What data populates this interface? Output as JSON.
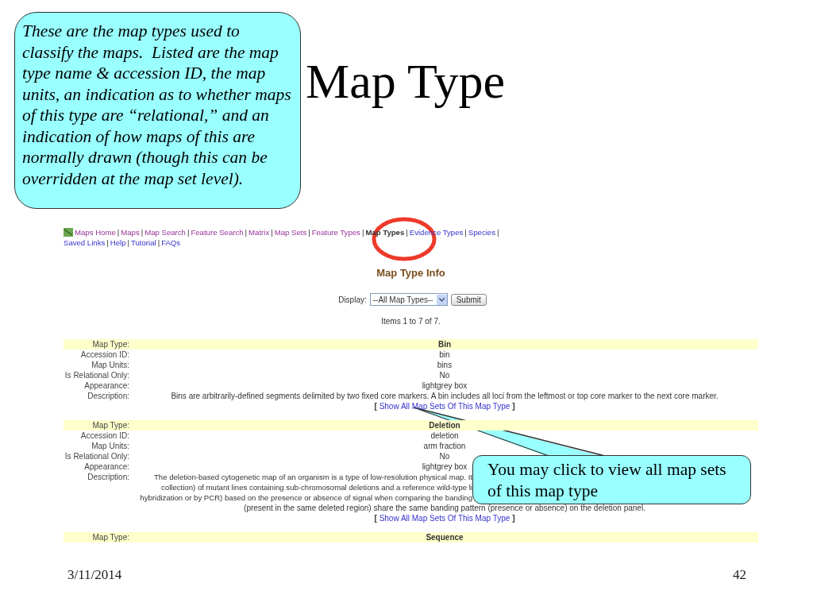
{
  "slide": {
    "title": "Map Type",
    "date": "3/11/2014",
    "page_number": "42"
  },
  "callouts": [
    {
      "kind": "note",
      "text": "These are the map types used to classify the maps.  Listed are the map type name & accession ID, the map units, an indication as to whether maps of this type are “relational,” and an indication of how maps of this are normally drawn (though this can be overridden at the map set level)."
    },
    {
      "kind": "pointer",
      "text": "You may click to view all map sets of this map type"
    }
  ],
  "screenshot": {
    "nav_separator": "|",
    "nav": [
      {
        "label": "Maps Home",
        "visited": true,
        "selected": false
      },
      {
        "label": "Maps",
        "visited": true,
        "selected": false
      },
      {
        "label": "Map Search",
        "visited": true,
        "selected": false
      },
      {
        "label": "Feature Search",
        "visited": true,
        "selected": false
      },
      {
        "label": "Matrix",
        "visited": true,
        "selected": false
      },
      {
        "label": "Map Sets",
        "visited": true,
        "selected": false
      },
      {
        "label": "Feature Types",
        "visited": true,
        "selected": false
      },
      {
        "label": "Map Types",
        "visited": false,
        "selected": true
      },
      {
        "label": "Evidence Types",
        "visited": false,
        "selected": false
      },
      {
        "label": "Species",
        "visited": false,
        "selected": false
      },
      {
        "label": "Saved Links",
        "visited": false,
        "selected": false
      },
      {
        "label": "Help",
        "visited": false,
        "selected": false
      },
      {
        "label": "Tutorial",
        "visited": false,
        "selected": false
      },
      {
        "label": "FAQs",
        "visited": false,
        "selected": false
      }
    ],
    "heading": "Map Type Info",
    "display": {
      "label": "Display:",
      "value": "--All Map Types--",
      "button": "Submit"
    },
    "items_count": "Items 1 to 7 of 7.",
    "records": [
      {
        "fields": [
          {
            "kind": "header",
            "label": "Map Type:",
            "value": "Bin"
          },
          {
            "kind": "plain",
            "label": "Accession ID:",
            "value": "bin"
          },
          {
            "kind": "plain",
            "label": "Map Units:",
            "value": "bins"
          },
          {
            "kind": "plain",
            "label": "Is Relational Only:",
            "value": "No"
          },
          {
            "kind": "plain",
            "label": "Appearance:",
            "value": "lightgrey box"
          },
          {
            "kind": "description",
            "label": "Description:",
            "lines": [
              {
                "kind": "whole",
                "text": "Bins are arbitrarily-defined segments delimited by two fixed core markers. A bin includes all loci from the leftmost or top core marker to the next core marker."
              }
            ]
          }
        ],
        "link": {
          "open": "[",
          "label": "Show All Map Sets Of This Map Type",
          "close": "]"
        }
      },
      {
        "fields": [
          {
            "kind": "header",
            "label": "Map Type:",
            "value": "Deletion"
          },
          {
            "kind": "plain",
            "label": "Accession ID:",
            "value": "deletion"
          },
          {
            "kind": "plain",
            "label": "Map Units:",
            "value": "arm fraction"
          },
          {
            "kind": "plain",
            "label": "Is Relational Only:",
            "value": "No"
          },
          {
            "kind": "plain",
            "label": "Appearance:",
            "value": "lightgrey box"
          },
          {
            "kind": "description",
            "label": "Description:",
            "lines": [
              {
                "kind": "cut",
                "text": "The deletion-based cytogenetic map of an organism is a type of low-resolution physical map. It"
              },
              {
                "kind": "cut",
                "text": "collection) of mutant lines containing sub-chromosomal deletions and a reference wild-type li"
              },
              {
                "kind": "cut",
                "text": "hybridization or by PCR) based on the presence or absence of signal when comparing the banding"
              },
              {
                "kind": "whole",
                "text": "(present in the same deleted region) share the same banding pattern (presence or absence) on the deletion panel."
              }
            ]
          }
        ],
        "link": {
          "open": "[",
          "label": "Show All Map Sets Of This Map Type",
          "close": "]"
        }
      },
      {
        "fields": [
          {
            "kind": "header",
            "label": "Map Type:",
            "value": "Sequence"
          }
        ]
      }
    ]
  }
}
